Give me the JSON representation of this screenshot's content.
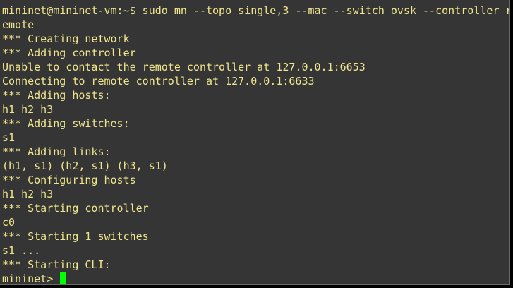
{
  "terminal": {
    "colors": {
      "background": "#353535",
      "text": "#f0e68c",
      "cursor": "#00ff00"
    },
    "lines": [
      "mininet@mininet-vm:~$ sudo mn --topo single,3 --mac --switch ovsk --controller r",
      "emote",
      "*** Creating network",
      "*** Adding controller",
      "Unable to contact the remote controller at 127.0.0.1:6653",
      "Connecting to remote controller at 127.0.0.1:6633",
      "*** Adding hosts:",
      "h1 h2 h3",
      "*** Adding switches:",
      "s1",
      "*** Adding links:",
      "(h1, s1) (h2, s1) (h3, s1)",
      "*** Configuring hosts",
      "h1 h2 h3",
      "*** Starting controller",
      "c0",
      "*** Starting 1 switches",
      "s1 ...",
      "*** Starting CLI:"
    ],
    "prompt": "mininet> "
  }
}
